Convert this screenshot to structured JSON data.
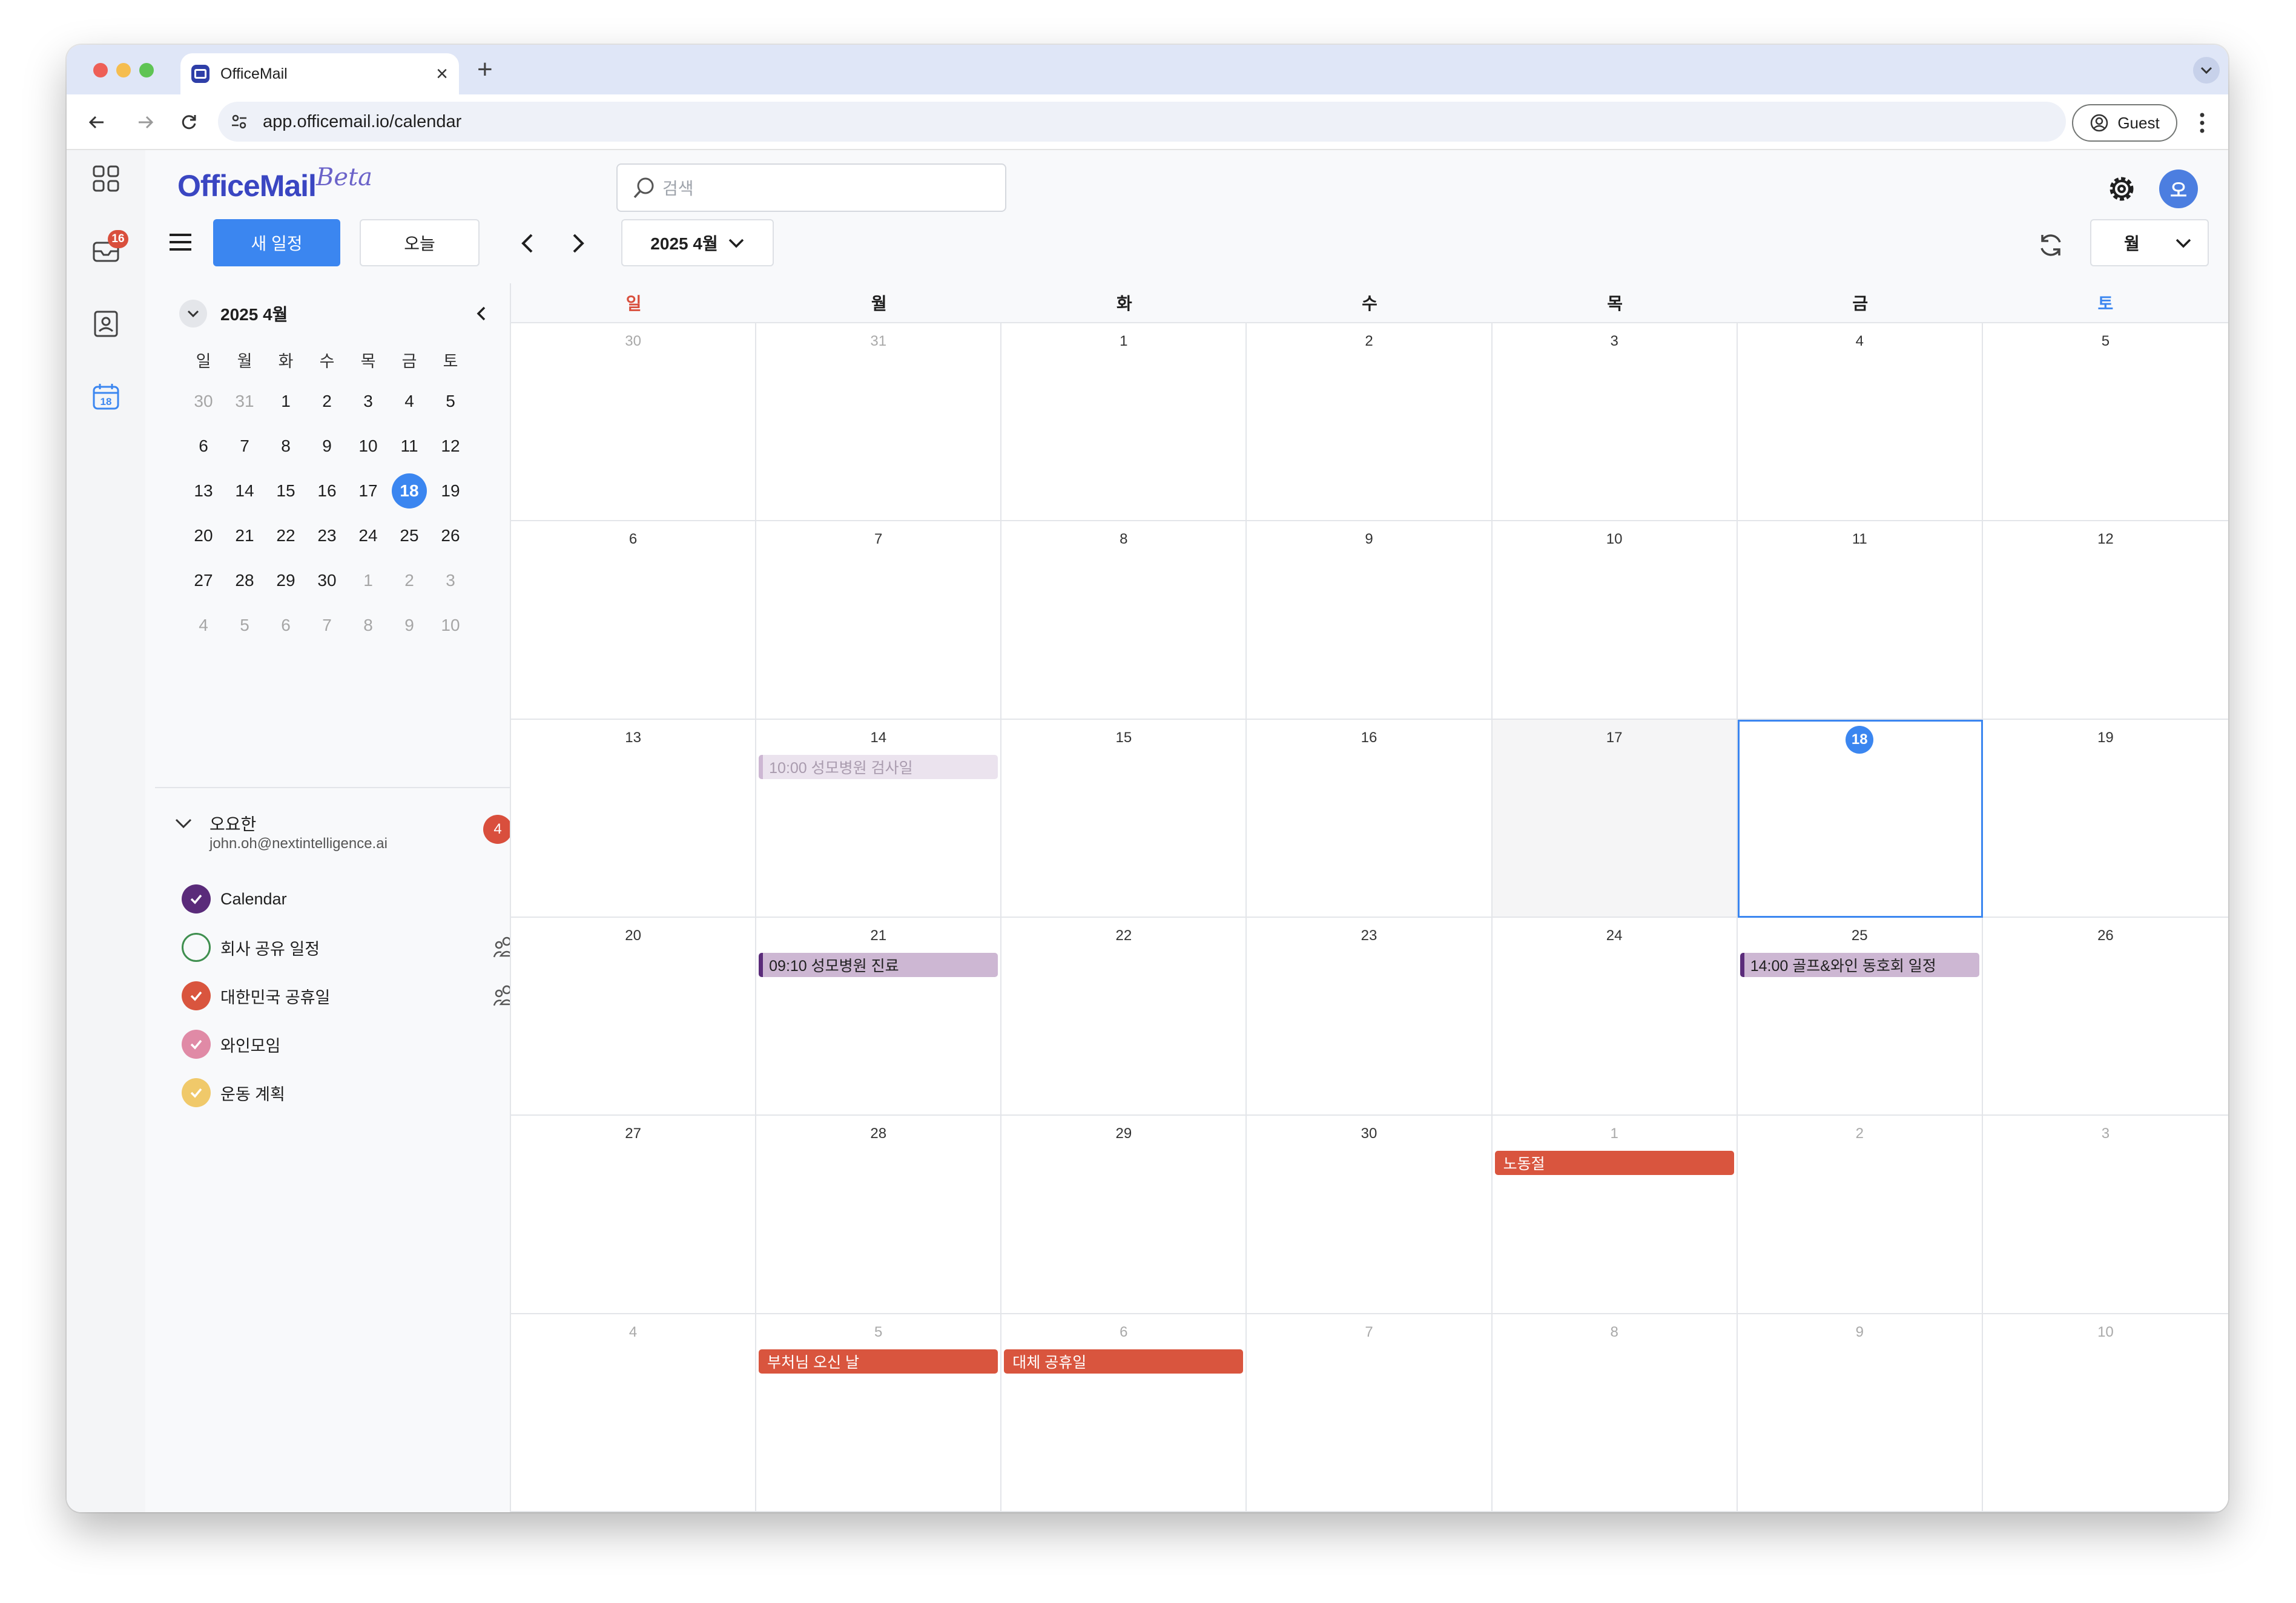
{
  "browser": {
    "tab_title": "OfficeMail",
    "url": "app.officemail.io/calendar",
    "guest_label": "Guest"
  },
  "rail": {
    "mail_badge": "16",
    "calendar_icon_day": "18"
  },
  "header": {
    "logo": "OfficeMail",
    "logo_beta": "Beta",
    "search_placeholder": "검색",
    "avatar_initial": "오"
  },
  "toolbar": {
    "new_event_label": "새 일정",
    "today_label": "오늘",
    "month_label": "2025 4월",
    "view_label": "월"
  },
  "mini_calendar": {
    "title": "2025 4월",
    "weekdays": [
      "일",
      "월",
      "화",
      "수",
      "목",
      "금",
      "토"
    ],
    "weeks": [
      [
        {
          "d": "30",
          "dim": true
        },
        {
          "d": "31",
          "dim": true
        },
        {
          "d": "1"
        },
        {
          "d": "2"
        },
        {
          "d": "3"
        },
        {
          "d": "4"
        },
        {
          "d": "5"
        }
      ],
      [
        {
          "d": "6"
        },
        {
          "d": "7"
        },
        {
          "d": "8"
        },
        {
          "d": "9"
        },
        {
          "d": "10"
        },
        {
          "d": "11"
        },
        {
          "d": "12"
        }
      ],
      [
        {
          "d": "13"
        },
        {
          "d": "14"
        },
        {
          "d": "15"
        },
        {
          "d": "16"
        },
        {
          "d": "17"
        },
        {
          "d": "18",
          "today": true
        },
        {
          "d": "19"
        }
      ],
      [
        {
          "d": "20"
        },
        {
          "d": "21"
        },
        {
          "d": "22"
        },
        {
          "d": "23"
        },
        {
          "d": "24"
        },
        {
          "d": "25"
        },
        {
          "d": "26"
        }
      ],
      [
        {
          "d": "27"
        },
        {
          "d": "28"
        },
        {
          "d": "29"
        },
        {
          "d": "30"
        },
        {
          "d": "1",
          "dim": true
        },
        {
          "d": "2",
          "dim": true
        },
        {
          "d": "3",
          "dim": true
        }
      ],
      [
        {
          "d": "4",
          "dim": true
        },
        {
          "d": "5",
          "dim": true
        },
        {
          "d": "6",
          "dim": true
        },
        {
          "d": "7",
          "dim": true
        },
        {
          "d": "8",
          "dim": true
        },
        {
          "d": "9",
          "dim": true
        },
        {
          "d": "10",
          "dim": true
        }
      ]
    ]
  },
  "account": {
    "name": "오요한",
    "email": "john.oh@nextintelligence.ai",
    "badge": "4"
  },
  "calendars": [
    {
      "name": "Calendar",
      "color": "#5a2b7a",
      "checked": true,
      "shared": false
    },
    {
      "name": "회사 공유 일정",
      "color": "#3f8f4f",
      "checked": false,
      "shared": true
    },
    {
      "name": "대한민국 공휴일",
      "color": "#d9553e",
      "checked": true,
      "shared": true
    },
    {
      "name": "와인모임",
      "color": "#e08aa6",
      "checked": true,
      "shared": false
    },
    {
      "name": "운동 계획",
      "color": "#f0c96a",
      "checked": true,
      "shared": false
    }
  ],
  "month_view": {
    "weekdays": [
      {
        "label": "일",
        "color": "#d94f3d"
      },
      {
        "label": "월",
        "color": "#1f1f1f"
      },
      {
        "label": "화",
        "color": "#1f1f1f"
      },
      {
        "label": "수",
        "color": "#1f1f1f"
      },
      {
        "label": "목",
        "color": "#1f1f1f"
      },
      {
        "label": "금",
        "color": "#1f1f1f"
      },
      {
        "label": "토",
        "color": "#3b86f0"
      }
    ],
    "weeks": [
      [
        {
          "d": "30",
          "dim": true
        },
        {
          "d": "31",
          "dim": true
        },
        {
          "d": "1"
        },
        {
          "d": "2"
        },
        {
          "d": "3"
        },
        {
          "d": "4"
        },
        {
          "d": "5"
        }
      ],
      [
        {
          "d": "6"
        },
        {
          "d": "7"
        },
        {
          "d": "8"
        },
        {
          "d": "9"
        },
        {
          "d": "10"
        },
        {
          "d": "11"
        },
        {
          "d": "12"
        }
      ],
      [
        {
          "d": "13"
        },
        {
          "d": "14",
          "event": {
            "label": "10:00 성모병원 검사일",
            "style": "faded"
          }
        },
        {
          "d": "15"
        },
        {
          "d": "16"
        },
        {
          "d": "17",
          "shade": true
        },
        {
          "d": "18",
          "today": true,
          "selected": true
        },
        {
          "d": "19"
        }
      ],
      [
        {
          "d": "20"
        },
        {
          "d": "21",
          "event": {
            "label": "09:10 성모병원 진료",
            "style": "pastel"
          }
        },
        {
          "d": "22"
        },
        {
          "d": "23"
        },
        {
          "d": "24"
        },
        {
          "d": "25",
          "event": {
            "label": "14:00 골프&와인 동호회 일정",
            "style": "pastel"
          }
        },
        {
          "d": "26"
        }
      ],
      [
        {
          "d": "27"
        },
        {
          "d": "28"
        },
        {
          "d": "29"
        },
        {
          "d": "30"
        },
        {
          "d": "1",
          "dim": true,
          "event": {
            "label": "노동절",
            "style": "red"
          }
        },
        {
          "d": "2",
          "dim": true
        },
        {
          "d": "3",
          "dim": true
        }
      ],
      [
        {
          "d": "4",
          "dim": true
        },
        {
          "d": "5",
          "dim": true,
          "event": {
            "label": "부처님 오신 날",
            "style": "red"
          }
        },
        {
          "d": "6",
          "dim": true,
          "event": {
            "label": "대체 공휴일",
            "style": "red"
          }
        },
        {
          "d": "7",
          "dim": true
        },
        {
          "d": "8",
          "dim": true
        },
        {
          "d": "9",
          "dim": true
        },
        {
          "d": "10",
          "dim": true
        }
      ]
    ]
  }
}
